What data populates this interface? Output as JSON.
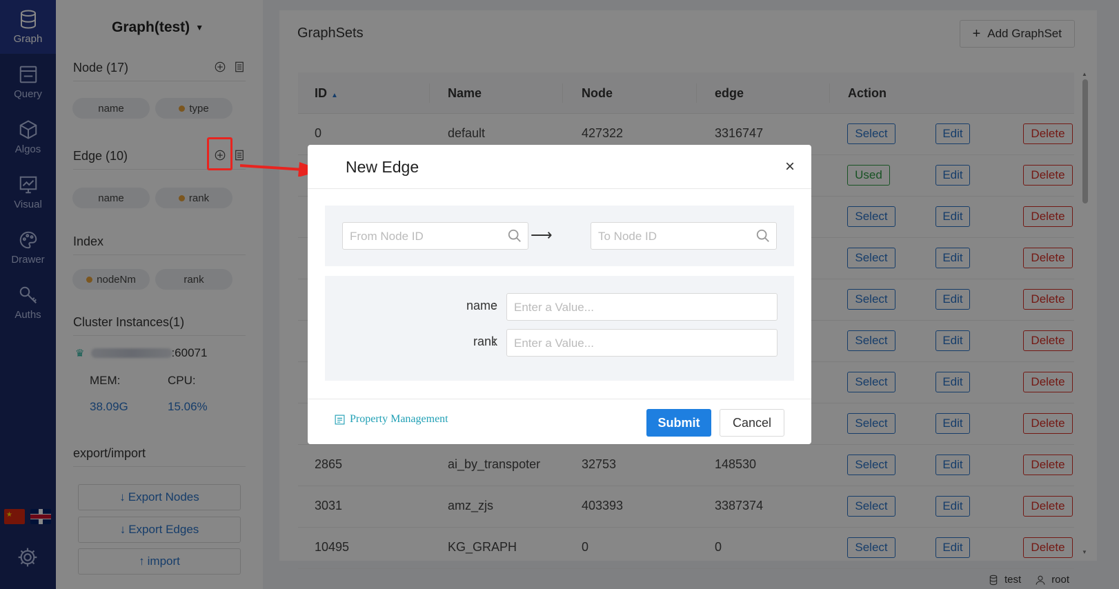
{
  "nav": {
    "items": [
      {
        "label": "Graph",
        "icon": "database-icon"
      },
      {
        "label": "Query",
        "icon": "query-icon"
      },
      {
        "label": "Algos",
        "icon": "cube-icon"
      },
      {
        "label": "Visual",
        "icon": "chart-icon"
      },
      {
        "label": "Drawer",
        "icon": "palette-icon"
      },
      {
        "label": "Auths",
        "icon": "key-icon"
      }
    ]
  },
  "side": {
    "graph_title": "Graph(test)",
    "node_section": "Node (17)",
    "node_props": [
      "name",
      "type"
    ],
    "edge_section": "Edge (10)",
    "edge_props": [
      "name",
      "rank"
    ],
    "index_section": "Index",
    "index_props": [
      "nodeNm",
      "rank"
    ],
    "cluster_section": "Cluster Instances(1)",
    "cluster_port": ":60071",
    "mem_label": "MEM:",
    "cpu_label": "CPU:",
    "mem_value": "38.09G",
    "cpu_value": "15.06%",
    "export_section": "export/import",
    "export_nodes": "Export Nodes",
    "export_edges": "Export Edges",
    "import": "import"
  },
  "main": {
    "title": "GraphSets",
    "add_button": "Add GraphSet",
    "columns": [
      "ID",
      "Name",
      "Node",
      "edge",
      "Action"
    ],
    "rows": [
      {
        "id": "0",
        "name": "default",
        "node": "427322",
        "edge": "3316747",
        "state": "Select"
      },
      {
        "id": "",
        "name": "",
        "node": "",
        "edge": "",
        "state": "Used"
      },
      {
        "id": "",
        "name": "",
        "node": "",
        "edge": "",
        "state": "Select"
      },
      {
        "id": "",
        "name": "",
        "node": "",
        "edge": "",
        "state": "Select"
      },
      {
        "id": "",
        "name": "",
        "node": "",
        "edge": "",
        "state": "Select"
      },
      {
        "id": "",
        "name": "",
        "node": "",
        "edge": "",
        "state": "Select"
      },
      {
        "id": "",
        "name": "",
        "node": "",
        "edge": "",
        "state": "Select"
      },
      {
        "id": "",
        "name": "",
        "node": "",
        "edge": "",
        "state": "Select"
      },
      {
        "id": "2865",
        "name": "ai_by_transpoter",
        "node": "32753",
        "edge": "148530",
        "state": "Select"
      },
      {
        "id": "3031",
        "name": "amz_zjs",
        "node": "403393",
        "edge": "3387374",
        "state": "Select"
      },
      {
        "id": "10495",
        "name": "KG_GRAPH",
        "node": "0",
        "edge": "0",
        "state": "Select"
      }
    ],
    "edit_label": "Edit",
    "delete_label": "Delete"
  },
  "status": {
    "db": "test",
    "user": "root"
  },
  "modal": {
    "title": "New Edge",
    "from_placeholder": "From Node ID",
    "to_placeholder": "To Node ID",
    "link_arrow": "⟶",
    "props": [
      {
        "label": "name",
        "placeholder": "Enter a Value..."
      },
      {
        "label": "rank",
        "placeholder": "Enter a Value..."
      }
    ],
    "colon": ":",
    "property_management": "Property Management",
    "submit": "Submit",
    "cancel": "Cancel",
    "close": "×"
  },
  "colors": {
    "nav_bg": "#1b2a66",
    "primary": "#1e7fe0",
    "delete": "#d93026",
    "used": "#2e9c44",
    "annotation": "#e8241f"
  }
}
